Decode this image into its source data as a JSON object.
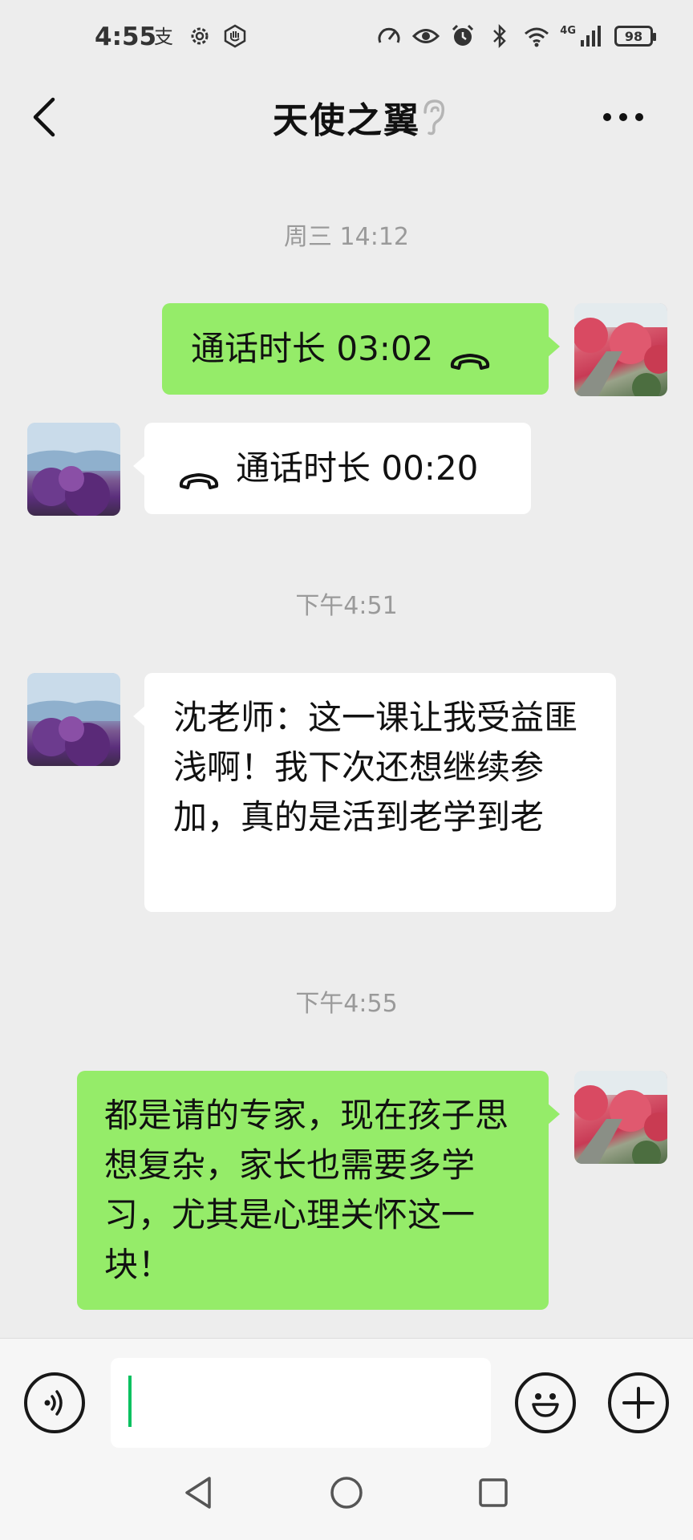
{
  "status_bar": {
    "time": "4:55",
    "left_icons": [
      "alipay-icon",
      "settings-icon",
      "hand-icon"
    ],
    "right_icons": [
      "speed-icon",
      "eye-icon",
      "alarm-icon",
      "bluetooth-icon",
      "wifi-icon",
      "signal-icon"
    ],
    "network": "4G",
    "battery": "98"
  },
  "header": {
    "title": "天使之翼",
    "back_icon": "back-chevron-icon",
    "earpiece_icon": "earpiece-icon",
    "more_icon": "more-dots-icon"
  },
  "chat": {
    "timestamps": [
      "周三 14:12",
      "下午4:51",
      "下午4:55"
    ],
    "messages": [
      {
        "sender": "self",
        "type": "call",
        "text": "通话时长 03:02"
      },
      {
        "sender": "other",
        "type": "call",
        "text": "通话时长 00:20"
      },
      {
        "sender": "other",
        "type": "text",
        "text": "沈老师：这一课让我受益匪浅啊！我下次还想继续参加，真的是活到老学到老"
      },
      {
        "sender": "self",
        "type": "text",
        "text": "都是请的专家，现在孩子思想复杂，家长也需要多学习，尤其是心理关怀这一块！"
      }
    ]
  },
  "input_bar": {
    "voice_icon": "voice-icon",
    "input_value": "",
    "emoji_icon": "emoji-icon",
    "plus_icon": "plus-icon"
  },
  "nav_bar": {
    "buttons": [
      "nav-back-icon",
      "nav-home-icon",
      "nav-recent-icon"
    ]
  },
  "colors": {
    "background": "#ededed",
    "bubble_out": "#95ec69",
    "bubble_in": "#ffffff",
    "cursor": "#07c160"
  }
}
